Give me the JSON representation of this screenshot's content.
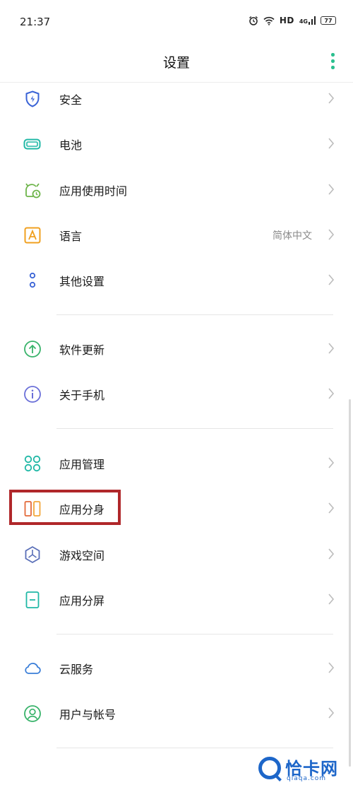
{
  "status_bar": {
    "time": "21:37",
    "network": "HD",
    "signal": "4G",
    "battery": "77"
  },
  "header": {
    "title": "设置",
    "more_icon": "more-vertical-icon",
    "accent_color": "#2bc08f"
  },
  "settings": {
    "items": [
      {
        "label": "安全",
        "icon": "shield-icon"
      },
      {
        "label": "电池",
        "icon": "battery-icon"
      },
      {
        "label": "应用使用时间",
        "icon": "app-usage-time-icon"
      },
      {
        "label": "语言",
        "icon": "language-icon",
        "value": "简体中文"
      },
      {
        "label": "其他设置",
        "icon": "other-settings-icon"
      },
      {
        "label": "软件更新",
        "icon": "software-update-icon"
      },
      {
        "label": "关于手机",
        "icon": "about-phone-icon"
      },
      {
        "label": "应用管理",
        "icon": "app-management-icon"
      },
      {
        "label": "应用分身",
        "icon": "app-clone-icon",
        "highlighted": true
      },
      {
        "label": "游戏空间",
        "icon": "game-space-icon"
      },
      {
        "label": "应用分屏",
        "icon": "split-screen-icon"
      },
      {
        "label": "云服务",
        "icon": "cloud-service-icon"
      },
      {
        "label": "用户与帐号",
        "icon": "user-account-icon"
      }
    ]
  },
  "highlight_color": "#b0272a",
  "watermark": {
    "name": "恰卡网",
    "domain": "qiaqa.com",
    "color": "#1d66c9"
  }
}
